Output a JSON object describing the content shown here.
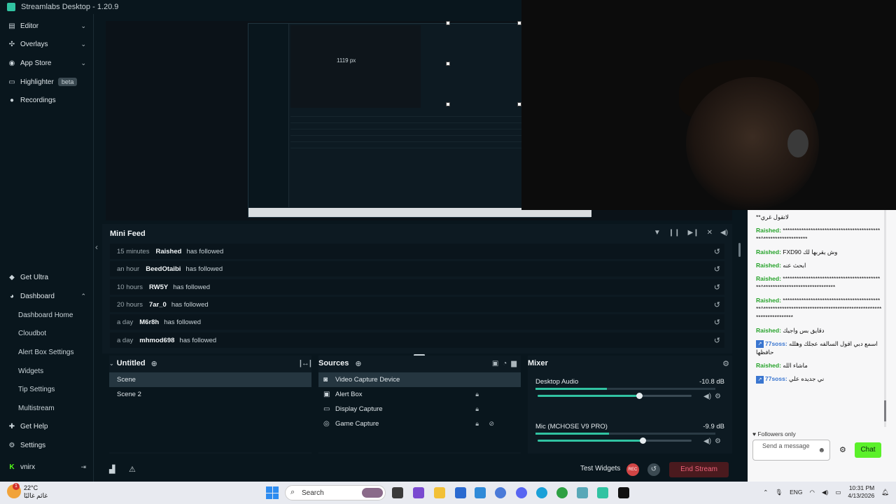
{
  "app": {
    "title": "Streamlabs Desktop - 1.20.9"
  },
  "sidebar": {
    "top": [
      {
        "label": "Editor",
        "icon": "editor-icon",
        "chevron": "⌄"
      },
      {
        "label": "Overlays",
        "icon": "overlays-icon",
        "chevron": "⌄"
      },
      {
        "label": "App Store",
        "icon": "app-store-icon",
        "chevron": "⌄"
      },
      {
        "label": "Highlighter",
        "icon": "highlighter-icon",
        "badge": "beta"
      },
      {
        "label": "Recordings",
        "icon": "recordings-icon"
      }
    ],
    "bottom": {
      "ultra": "Get Ultra",
      "dashboard": "Dashboard",
      "dashboard_items": [
        "Dashboard Home",
        "Cloudbot",
        "Alert Box Settings",
        "Widgets",
        "Tip Settings",
        "Multistream"
      ],
      "help": "Get Help",
      "settings": "Settings",
      "user": "vnirx"
    }
  },
  "preview": {
    "measure": "1119 px"
  },
  "mini_feed": {
    "title": "Mini Feed",
    "rows": [
      {
        "time": "15 minutes",
        "user": "Raished",
        "action": "has followed"
      },
      {
        "time": "an hour",
        "user": "BeedOtaibi",
        "action": "has followed"
      },
      {
        "time": "10 hours",
        "user": "RW5Y",
        "action": "has followed"
      },
      {
        "time": "20 hours",
        "user": "7ar_0",
        "action": "has followed"
      },
      {
        "time": "a day",
        "user": "M6r8h",
        "action": "has followed"
      },
      {
        "time": "a day",
        "user": "mhmod698",
        "action": "has followed"
      }
    ]
  },
  "scenes": {
    "title": "Untitled",
    "items": [
      "Scene",
      "Scene 2"
    ]
  },
  "sources": {
    "title": "Sources",
    "items": [
      {
        "label": "Video Capture Device",
        "icon": "webcam-icon"
      },
      {
        "label": "Alert Box",
        "icon": "alert-box-icon"
      },
      {
        "label": "Display Capture",
        "icon": "monitor-icon"
      },
      {
        "label": "Game Capture",
        "icon": "gamepad-icon"
      }
    ]
  },
  "mixer": {
    "title": "Mixer",
    "channels": [
      {
        "name": "Desktop Audio",
        "db": "-10.8 dB",
        "level": 0.66
      },
      {
        "name": "Mic (MCHOSE V9 PRO)",
        "db": "-9.9 dB",
        "level": 0.68
      }
    ]
  },
  "footer": {
    "test_widgets": "Test Widgets",
    "rec": "REC",
    "end_stream": "End Stream"
  },
  "chat": {
    "messages": [
      {
        "name": "",
        "text": "**لاتقول غري"
      },
      {
        "name": "Raished:",
        "text": "********************************************^*******************"
      },
      {
        "name": "Raished:",
        "text": "FXD90 وش يقربها لك"
      },
      {
        "name": "Raished:",
        "text": "ابحث عنه"
      },
      {
        "name": "Raished:",
        "text": "********************************************^*******************************"
      },
      {
        "name": "Raished:",
        "text": "********************************************^*******************************************************************"
      },
      {
        "name": "Raished:",
        "text": "دقايق بس واجيك"
      },
      {
        "name": "77soss:",
        "text": "اسمع دبي اقول السالفه عجلك وهلله حافظها",
        "blue": true
      },
      {
        "name": "Raished:",
        "text": "ماشاء الله"
      },
      {
        "name": "77soss:",
        "text": "ني جديده علي",
        "blue": true
      }
    ],
    "followers_only": "Followers only",
    "placeholder": "Send a message",
    "button": "Chat"
  },
  "taskbar": {
    "temp": "22°C",
    "location": "غائم غالبًا",
    "search": "Search",
    "lang": "ENG",
    "time": "10:31 PM",
    "date": "4/13/2026",
    "notif": "1"
  }
}
